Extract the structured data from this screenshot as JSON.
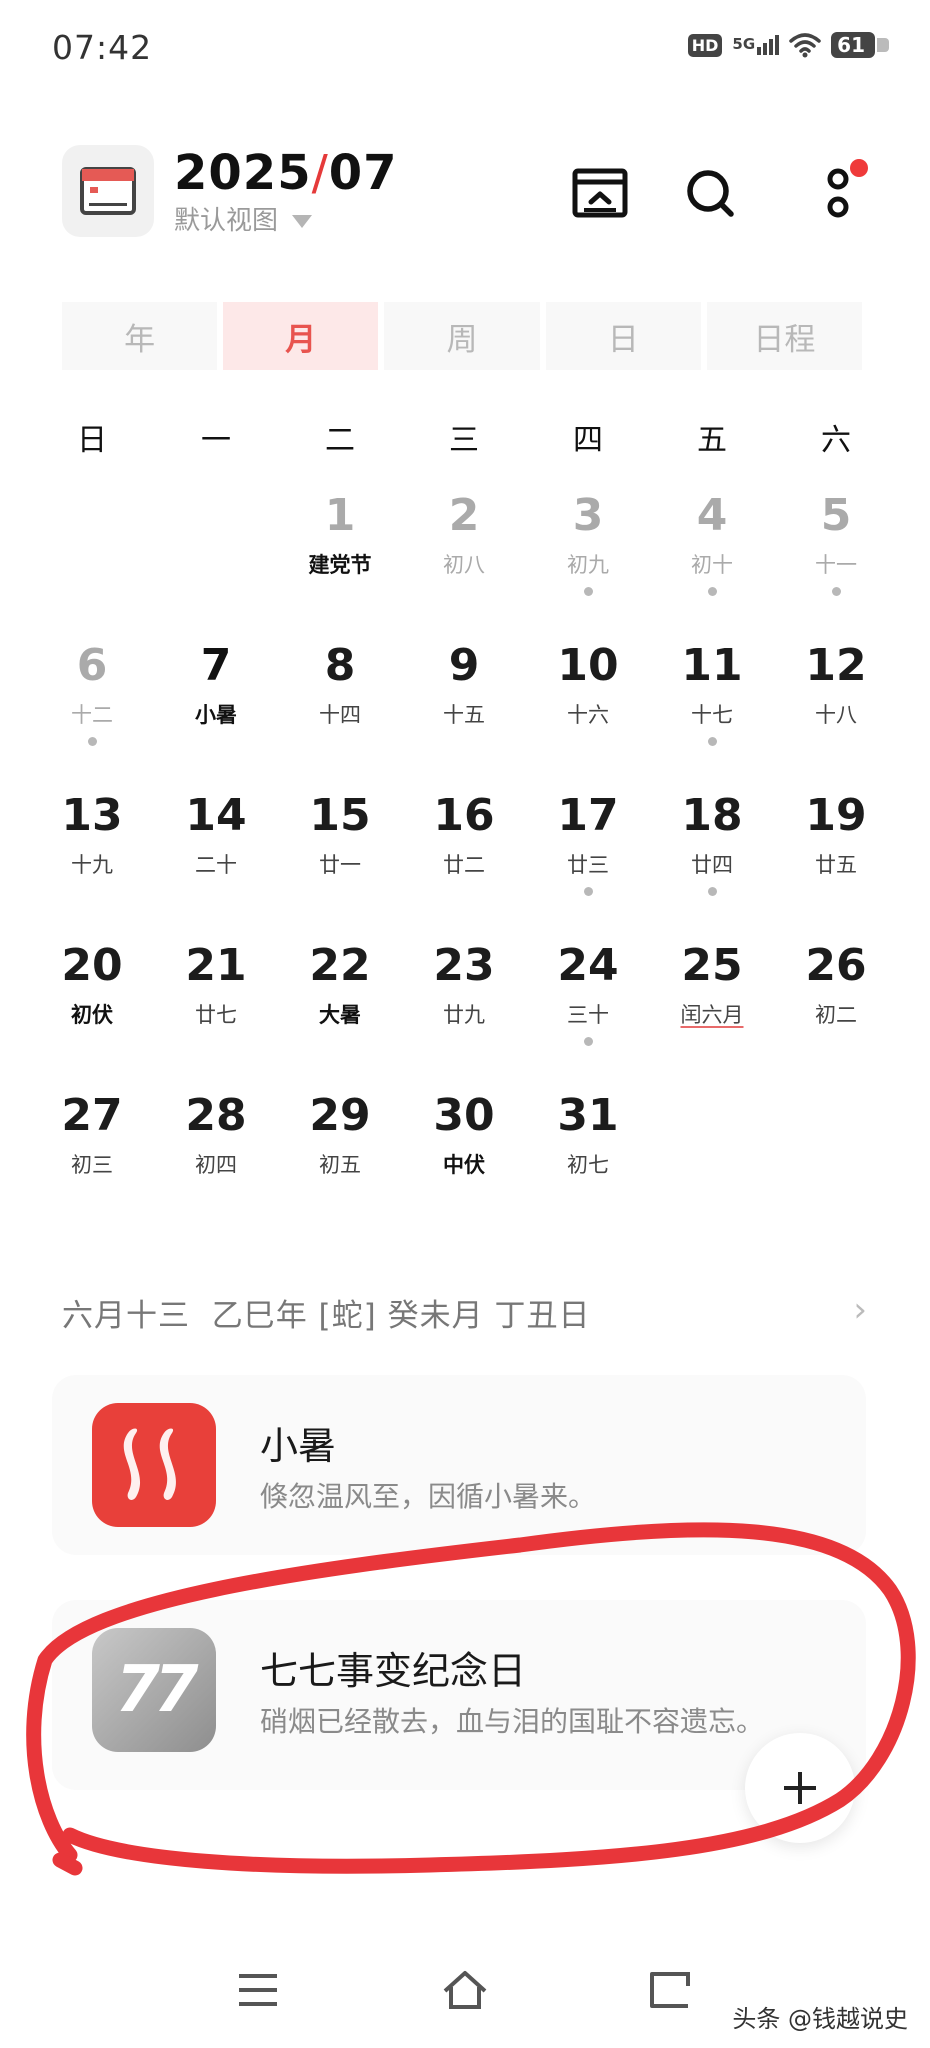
{
  "status_bar": {
    "time": "07:42",
    "hd": "HD",
    "network": "5G",
    "battery": "61"
  },
  "header": {
    "year": "2025",
    "separator": "/",
    "month": "07",
    "view_label": "默认视图"
  },
  "tabs": [
    {
      "label": "年",
      "active": false
    },
    {
      "label": "月",
      "active": true
    },
    {
      "label": "周",
      "active": false
    },
    {
      "label": "日",
      "active": false
    },
    {
      "label": "日程",
      "active": false
    }
  ],
  "weekdays": [
    "日",
    "一",
    "二",
    "三",
    "四",
    "五",
    "六"
  ],
  "days": [
    {
      "n": "",
      "sub": ""
    },
    {
      "n": "",
      "sub": ""
    },
    {
      "n": "1",
      "sub": "建党节",
      "bold": true,
      "faded": true
    },
    {
      "n": "2",
      "sub": "初八",
      "faded": true
    },
    {
      "n": "3",
      "sub": "初九",
      "faded": true,
      "dot": true
    },
    {
      "n": "4",
      "sub": "初十",
      "faded": true,
      "dot": true
    },
    {
      "n": "5",
      "sub": "十一",
      "faded": true,
      "dot": true
    },
    {
      "n": "6",
      "sub": "十二",
      "faded": true,
      "dot": true
    },
    {
      "n": "7",
      "sub": "小暑",
      "today": true
    },
    {
      "n": "8",
      "sub": "十四"
    },
    {
      "n": "9",
      "sub": "十五"
    },
    {
      "n": "10",
      "sub": "十六"
    },
    {
      "n": "11",
      "sub": "十七",
      "dot": true
    },
    {
      "n": "12",
      "sub": "十八"
    },
    {
      "n": "13",
      "sub": "十九"
    },
    {
      "n": "14",
      "sub": "二十"
    },
    {
      "n": "15",
      "sub": "廿一"
    },
    {
      "n": "16",
      "sub": "廿二"
    },
    {
      "n": "17",
      "sub": "廿三",
      "dot": true
    },
    {
      "n": "18",
      "sub": "廿四",
      "dot": true
    },
    {
      "n": "19",
      "sub": "廿五"
    },
    {
      "n": "20",
      "sub": "初伏",
      "bold": true
    },
    {
      "n": "21",
      "sub": "廿七"
    },
    {
      "n": "22",
      "sub": "大暑",
      "bold": true
    },
    {
      "n": "23",
      "sub": "廿九"
    },
    {
      "n": "24",
      "sub": "三十",
      "dot": true
    },
    {
      "n": "25",
      "sub": "闰六月",
      "underline": true
    },
    {
      "n": "26",
      "sub": "初二"
    },
    {
      "n": "27",
      "sub": "初三"
    },
    {
      "n": "28",
      "sub": "初四"
    },
    {
      "n": "29",
      "sub": "初五"
    },
    {
      "n": "30",
      "sub": "中伏",
      "bold": true
    },
    {
      "n": "31",
      "sub": "初七"
    }
  ],
  "lunar_info": "六月十三  乙巳年 [蛇] 癸未月 丁丑日",
  "events": [
    {
      "title": "小暑",
      "desc": "倏忽温风至，因循小暑来。",
      "icon": "heat-waves-icon",
      "color": "#e8403a"
    },
    {
      "title": "七七事变纪念日",
      "desc": "硝烟已经散去，血与泪的国耻不容遗忘。",
      "icon": "77-icon",
      "icon_text": "77",
      "color": "#a8a8a8"
    }
  ],
  "fab_icon": "plus-icon",
  "watermark": "头条 @钱越说史",
  "colors": {
    "accent": "#e8544f",
    "annotation": "#e8363a"
  }
}
